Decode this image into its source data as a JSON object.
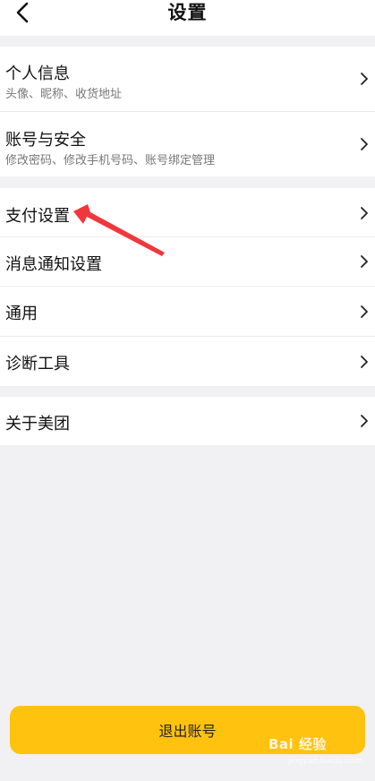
{
  "header": {
    "title": "设置",
    "back_icon": "chevron-left-icon"
  },
  "group1": [
    {
      "label": "个人信息",
      "sub": "头像、昵称、收货地址"
    },
    {
      "label": "账号与安全",
      "sub": "修改密码、修改手机号码、账号绑定管理"
    }
  ],
  "group2": [
    {
      "label": "支付设置"
    },
    {
      "label": "消息通知设置"
    },
    {
      "label": "通用"
    },
    {
      "label": "诊断工具"
    }
  ],
  "group3": [
    {
      "label": "关于美团"
    }
  ],
  "footer": {
    "logout_label": "退出账号"
  },
  "watermark": {
    "text": "Bai 经验",
    "sub": "jingyan.baidu.com"
  },
  "colors": {
    "accent": "#ffc20f",
    "annotation_arrow": "#f0373c"
  }
}
